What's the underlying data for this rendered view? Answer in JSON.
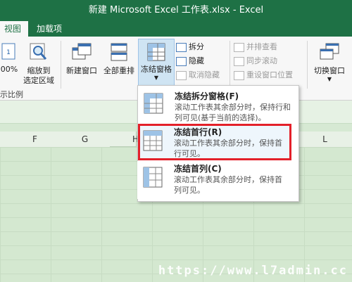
{
  "window": {
    "title": "新建 Microsoft Excel 工作表.xlsx - Excel"
  },
  "tabs": [
    {
      "label": "视图"
    },
    {
      "label": "加载项"
    }
  ],
  "ribbon": {
    "zoom_partial": "00%",
    "zoom_to_selection": {
      "line1": "缩放到",
      "line2": "选定区域"
    },
    "zoom_group_label": "示比例",
    "new_window": "新建窗口",
    "arrange_all": "全部重排",
    "freeze_panes": "冻结窗格",
    "split": "拆分",
    "hide": "隐藏",
    "unhide": "取消隐藏",
    "view_side_by_side": "并排查看",
    "sync_scroll": "同步滚动",
    "reset_window": "重设窗口位置",
    "switch_windows": "切换窗口"
  },
  "columns": [
    "F",
    "G",
    "H",
    "L"
  ],
  "menu": {
    "items": [
      {
        "title": "冻结拆分窗格(F)",
        "desc": "滚动工作表其余部分时，保持行和列可见(基于当前的选择)。"
      },
      {
        "title": "冻结首行(R)",
        "desc": "滚动工作表其余部分时，保持首行可见。"
      },
      {
        "title": "冻结首列(C)",
        "desc": "滚动工作表其余部分时，保持首列可见。"
      }
    ]
  },
  "watermark": "https://www.l7admin.cc",
  "colors": {
    "accent": "#1e7145",
    "highlight": "#e3202a",
    "grid": "#d4e8d0"
  }
}
